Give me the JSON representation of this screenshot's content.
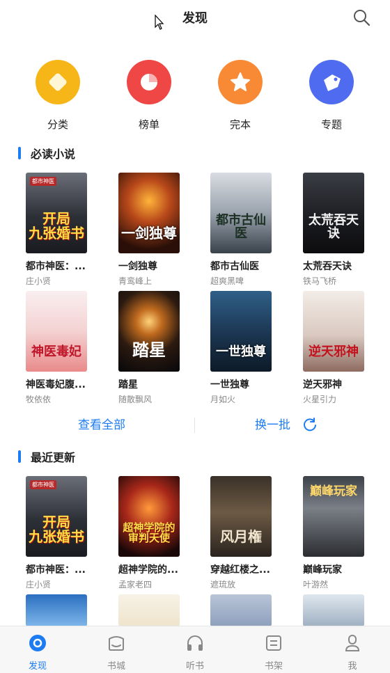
{
  "header": {
    "title": "发现"
  },
  "categories": [
    {
      "label": "分类",
      "icon": "category-icon",
      "color": "#f7b617"
    },
    {
      "label": "榜单",
      "icon": "ranking-icon",
      "color": "#ef4646"
    },
    {
      "label": "完本",
      "icon": "finished-star-icon",
      "color": "#f98a35"
    },
    {
      "label": "专题",
      "icon": "topic-tag-icon",
      "color": "#4f6cf0"
    }
  ],
  "must_read": {
    "title": "必读小说",
    "books": [
      {
        "name": "都市神医：...",
        "author": "庄小贤",
        "cover_text": "开局\n九张婚书",
        "badge": "都市神医"
      },
      {
        "name": "一剑独尊",
        "author": "青鸾峰上",
        "cover_text": "一剑独尊",
        "badge": ""
      },
      {
        "name": "都市古仙医",
        "author": "超爽黑啤",
        "cover_text": "都市古仙医",
        "badge": ""
      },
      {
        "name": "太荒吞天诀",
        "author": "铁马飞桥",
        "cover_text": "太荒吞天诀",
        "badge": ""
      },
      {
        "name": "神医毒妃腹...",
        "author": "牧依依",
        "cover_text": "神医毒妃",
        "badge": ""
      },
      {
        "name": "踏星",
        "author": "随散飘风",
        "cover_text": "踏星",
        "badge": ""
      },
      {
        "name": "一世独尊",
        "author": "月如火",
        "cover_text": "一世独尊",
        "badge": ""
      },
      {
        "name": "逆天邪神",
        "author": "火星引力",
        "cover_text": "逆天邪神",
        "badge": ""
      }
    ]
  },
  "actions": {
    "view_all": "查看全部",
    "refresh": "换一批"
  },
  "recent": {
    "title": "最近更新",
    "books": [
      {
        "name": "都市神医：...",
        "author": "庄小贤",
        "cover_text": "开局\n九张婚书",
        "badge": "都市神医"
      },
      {
        "name": "超神学院的...",
        "author": "孟家老四",
        "cover_text": "超神学院的\n审判天使",
        "badge": ""
      },
      {
        "name": "穿越红楼之...",
        "author": "遮琉放",
        "cover_text": "风月権",
        "badge": ""
      },
      {
        "name": "巅峰玩家",
        "author": "叶游然",
        "cover_text": "巅峰玩家",
        "badge": ""
      }
    ]
  },
  "tabbar": [
    {
      "label": "发现",
      "icon": "discover-icon",
      "active": true
    },
    {
      "label": "书城",
      "icon": "bookstore-icon",
      "active": false
    },
    {
      "label": "听书",
      "icon": "headphones-icon",
      "active": false
    },
    {
      "label": "书架",
      "icon": "bookshelf-icon",
      "active": false
    },
    {
      "label": "我",
      "icon": "profile-icon",
      "active": false
    }
  ],
  "colors": {
    "accent": "#1d7cf2",
    "text": "#222222",
    "muted": "#888888"
  }
}
